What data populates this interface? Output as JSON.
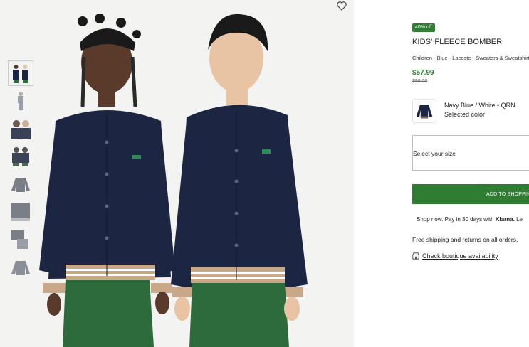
{
  "gallery": {
    "main_image": "kids-fleece-bomber-photo",
    "thumbnails": [
      {
        "name": "two-kids-front"
      },
      {
        "name": "kid-full-body"
      },
      {
        "name": "kids-closeup"
      },
      {
        "name": "kids-back"
      },
      {
        "name": "jacket-flat-front"
      },
      {
        "name": "jacket-flat-folded"
      },
      {
        "name": "outfit-flat"
      },
      {
        "name": "jacket-flat-back"
      }
    ]
  },
  "product": {
    "badge": "40% off",
    "title": "KIDS' FLEECE BOMBER",
    "breadcrumb": "Children - Blue - Lacoste - Sweaters & Sweatshirts",
    "price": "$57.99",
    "old_price": "$98.00",
    "color": {
      "name": "Navy Blue / White • QRN",
      "selected_label": "Selected color"
    },
    "size_select": {
      "placeholder": "Select your size"
    },
    "add_button": "ADD TO SHOPPING BAG",
    "klarna": {
      "text": "Shop now. Pay in 30 days with ",
      "brand": "Klarna.",
      "suffix": " Le"
    },
    "shipping": "Free shipping and returns on all orders.",
    "boutique_link": "Check boutique availability"
  },
  "colors": {
    "accent": "#2e7d32",
    "navy": "#1c2541",
    "gallery_bg": "#f3f3f2"
  }
}
